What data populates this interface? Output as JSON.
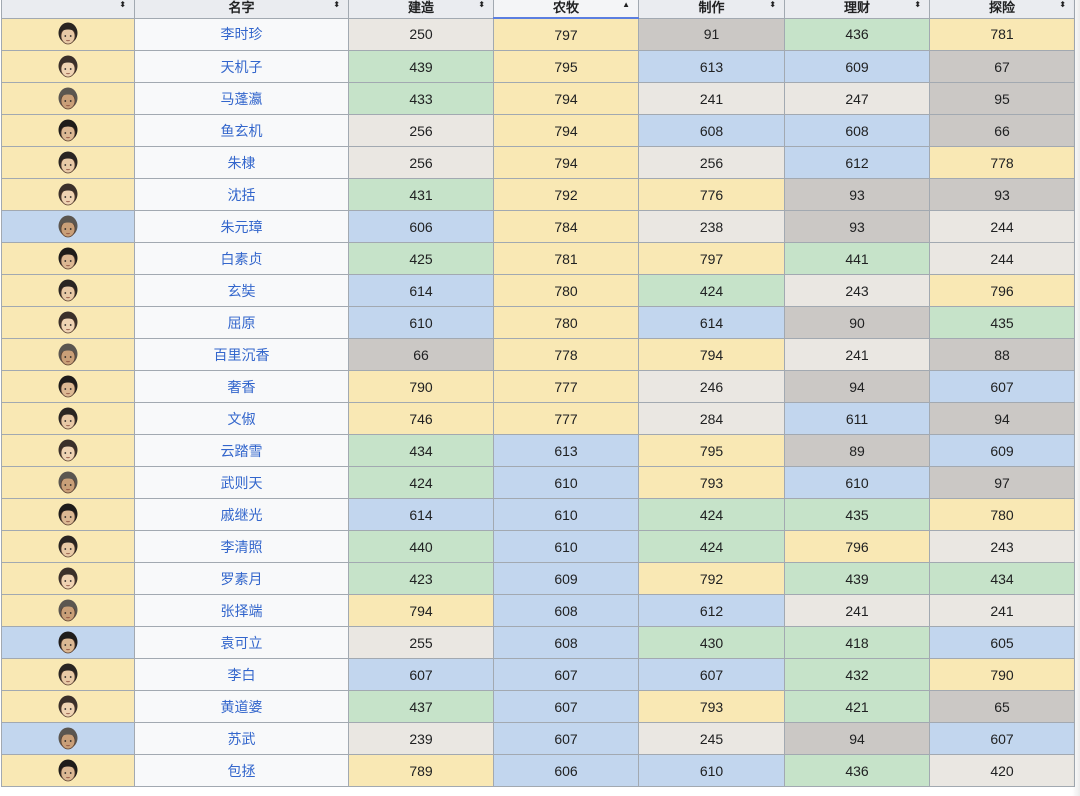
{
  "table": {
    "headers": [
      "",
      "名字",
      "建造",
      "农牧",
      "制作",
      "理财",
      "探险"
    ],
    "sort_glyphs": [
      "⬍",
      "⬍",
      "⬍",
      "▲",
      "⬍",
      "⬍",
      "⬍"
    ],
    "sorted_column": 3,
    "rows": [
      {
        "name": "李时珍",
        "portrait": "Y",
        "values": [
          250,
          797,
          91,
          436,
          781
        ],
        "cells": [
          "W",
          "Y",
          "D",
          "G",
          "Y"
        ]
      },
      {
        "name": "天机子",
        "portrait": "Y",
        "values": [
          439,
          795,
          613,
          609,
          67
        ],
        "cells": [
          "G",
          "Y",
          "B",
          "B",
          "D"
        ]
      },
      {
        "name": "马蓬瀛",
        "portrait": "Y",
        "values": [
          433,
          794,
          241,
          247,
          95
        ],
        "cells": [
          "G",
          "Y",
          "W",
          "W",
          "D"
        ]
      },
      {
        "name": "鱼玄机",
        "portrait": "Y",
        "values": [
          256,
          794,
          608,
          608,
          66
        ],
        "cells": [
          "W",
          "Y",
          "B",
          "B",
          "D"
        ]
      },
      {
        "name": "朱棣",
        "portrait": "Y",
        "values": [
          256,
          794,
          256,
          612,
          778
        ],
        "cells": [
          "W",
          "Y",
          "W",
          "B",
          "Y"
        ]
      },
      {
        "name": "沈括",
        "portrait": "Y",
        "values": [
          431,
          792,
          776,
          93,
          93
        ],
        "cells": [
          "G",
          "Y",
          "Y",
          "D",
          "D"
        ]
      },
      {
        "name": "朱元璋",
        "portrait": "B",
        "values": [
          606,
          784,
          238,
          93,
          244
        ],
        "cells": [
          "B",
          "Y",
          "W",
          "D",
          "W"
        ]
      },
      {
        "name": "白素贞",
        "portrait": "Y",
        "values": [
          425,
          781,
          797,
          441,
          244
        ],
        "cells": [
          "G",
          "Y",
          "Y",
          "G",
          "W"
        ]
      },
      {
        "name": "玄奘",
        "portrait": "Y",
        "values": [
          614,
          780,
          424,
          243,
          796
        ],
        "cells": [
          "B",
          "Y",
          "G",
          "W",
          "Y"
        ]
      },
      {
        "name": "屈原",
        "portrait": "Y",
        "values": [
          610,
          780,
          614,
          90,
          435
        ],
        "cells": [
          "B",
          "Y",
          "B",
          "D",
          "G"
        ]
      },
      {
        "name": "百里沉香",
        "portrait": "Y",
        "values": [
          66,
          778,
          794,
          241,
          88
        ],
        "cells": [
          "D",
          "Y",
          "Y",
          "W",
          "D"
        ]
      },
      {
        "name": "奢香",
        "portrait": "Y",
        "values": [
          790,
          777,
          246,
          94,
          607
        ],
        "cells": [
          "Y",
          "Y",
          "W",
          "D",
          "B"
        ]
      },
      {
        "name": "文俶",
        "portrait": "Y",
        "values": [
          746,
          777,
          284,
          611,
          94
        ],
        "cells": [
          "Y",
          "Y",
          "W",
          "B",
          "D"
        ]
      },
      {
        "name": "云踏雪",
        "portrait": "Y",
        "values": [
          434,
          613,
          795,
          89,
          609
        ],
        "cells": [
          "G",
          "B",
          "Y",
          "D",
          "B"
        ]
      },
      {
        "name": "武则天",
        "portrait": "Y",
        "values": [
          424,
          610,
          793,
          610,
          97
        ],
        "cells": [
          "G",
          "B",
          "Y",
          "B",
          "D"
        ]
      },
      {
        "name": "戚继光",
        "portrait": "Y",
        "values": [
          614,
          610,
          424,
          435,
          780
        ],
        "cells": [
          "B",
          "B",
          "G",
          "G",
          "Y"
        ]
      },
      {
        "name": "李清照",
        "portrait": "Y",
        "values": [
          440,
          610,
          424,
          796,
          243
        ],
        "cells": [
          "G",
          "B",
          "G",
          "Y",
          "W"
        ]
      },
      {
        "name": "罗素月",
        "portrait": "Y",
        "values": [
          423,
          609,
          792,
          439,
          434
        ],
        "cells": [
          "G",
          "B",
          "Y",
          "G",
          "G"
        ]
      },
      {
        "name": "张择端",
        "portrait": "Y",
        "values": [
          794,
          608,
          612,
          241,
          241
        ],
        "cells": [
          "Y",
          "B",
          "B",
          "W",
          "W"
        ]
      },
      {
        "name": "袁可立",
        "portrait": "B",
        "values": [
          255,
          608,
          430,
          418,
          605
        ],
        "cells": [
          "W",
          "B",
          "G",
          "G",
          "B"
        ]
      },
      {
        "name": "李白",
        "portrait": "Y",
        "values": [
          607,
          607,
          607,
          432,
          790
        ],
        "cells": [
          "B",
          "B",
          "B",
          "G",
          "Y"
        ]
      },
      {
        "name": "黄道婆",
        "portrait": "Y",
        "values": [
          437,
          607,
          793,
          421,
          65
        ],
        "cells": [
          "G",
          "B",
          "Y",
          "G",
          "D"
        ]
      },
      {
        "name": "苏武",
        "portrait": "B",
        "values": [
          239,
          607,
          245,
          94,
          607
        ],
        "cells": [
          "W",
          "B",
          "W",
          "D",
          "B"
        ]
      },
      {
        "name": "包拯",
        "portrait": "Y",
        "values": [
          789,
          606,
          610,
          436,
          420
        ],
        "cells": [
          "Y",
          "B",
          "B",
          "G",
          "W"
        ]
      }
    ]
  },
  "colors": {
    "Y": "#f9e8b4",
    "B": "#c2d6ee",
    "G": "#c6e3c9",
    "W": "#eae7e2",
    "D": "#cbc8c5",
    "link": "#3366cc",
    "header_bg": "#eaecf0",
    "border": "#a2a9b1"
  },
  "icons": {
    "portrait": "character-portrait-icon",
    "sort": "sort-toggle-icon"
  }
}
